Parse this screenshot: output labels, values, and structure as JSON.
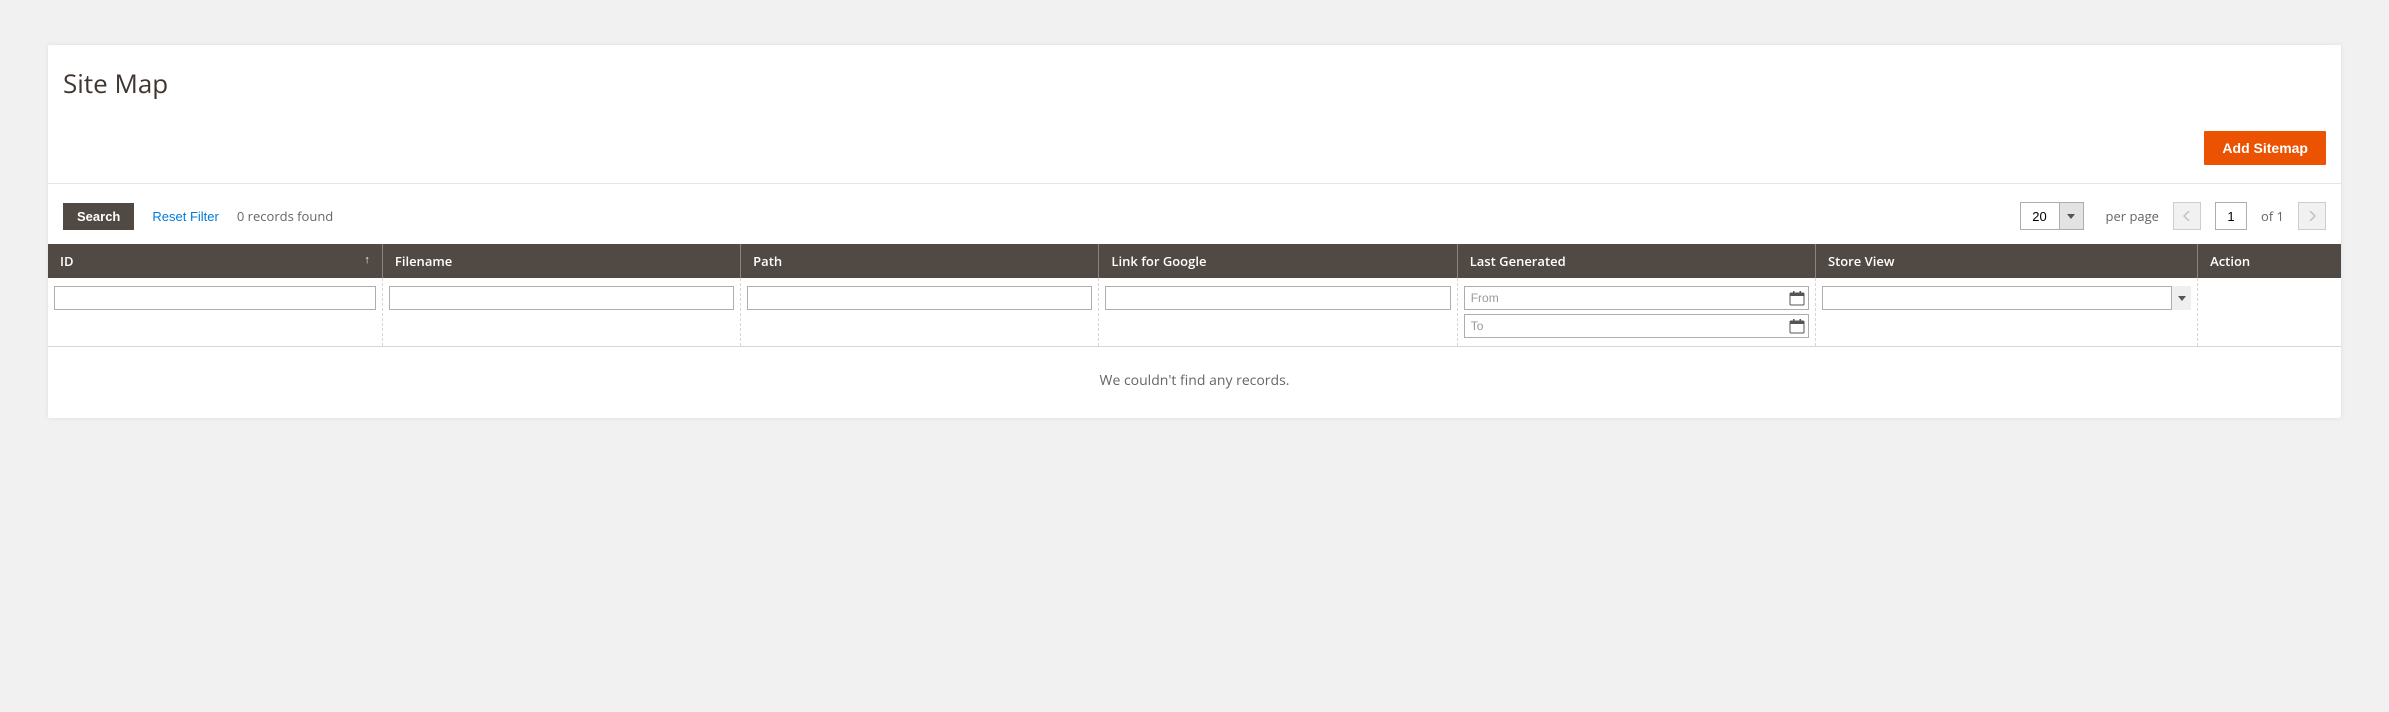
{
  "page": {
    "title": "Site Map",
    "add_button": "Add Sitemap"
  },
  "controls": {
    "search_label": "Search",
    "reset_label": "Reset Filter",
    "records_found": "0 records found",
    "page_size": "20",
    "per_page_label": "per page",
    "current_page": "1",
    "of_label": "of 1"
  },
  "columns": {
    "id": "ID",
    "filename": "Filename",
    "path": "Path",
    "link": "Link for Google",
    "last_generated": "Last Generated",
    "store_view": "Store View",
    "action": "Action"
  },
  "filters": {
    "from_placeholder": "From",
    "to_placeholder": "To"
  },
  "no_records": "We couldn't find any records."
}
